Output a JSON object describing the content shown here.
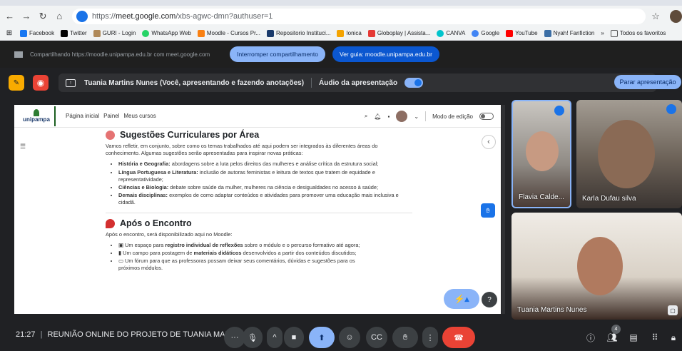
{
  "browser": {
    "url_prefix": "https://",
    "url_domain": "meet.google.com",
    "url_path": "/xbs-agwc-dmn?authuser=1",
    "bookmarks": [
      "Facebook",
      "Twitter",
      "GURI - Login",
      "WhatsApp Web",
      "Moodle - Cursos Pr...",
      "Repositorio Instituci...",
      "Ionica",
      "Globoplay | Assista...",
      "CANVA",
      "Google",
      "YouTube",
      "Nyah! Fanfiction",
      "»",
      "Todos os favoritos"
    ]
  },
  "share_bar": {
    "text": "Compartilhando https://moodle.unipampa.edu.br com meet.google.com",
    "stop_sharing": "Interromper compartilhamento",
    "see_tab": "Ver guia: moodle.unipampa.edu.br"
  },
  "present_bar": {
    "info": "Tuania Martins Nunes (Você, apresentando e fazendo anotações)",
    "audio": "Áudio da apresentação",
    "stop": "Parar apresentação"
  },
  "moodle": {
    "logo": "unipampa",
    "nav": [
      "Página inicial",
      "Painel",
      "Meus cursos"
    ],
    "edit_mode": "Modo de edição",
    "section1_title": "Sugestões Curriculares por Área",
    "section1_intro": "Vamos refletir, em conjunto, sobre como os temas trabalhados até aqui podem ser integrados às diferentes áreas do conhecimento. Algumas sugestões serão apresentadas para inspirar novas práticas:",
    "section1_items": [
      {
        "bold": "História e Geografia:",
        "text": " abordagens sobre a luta pelos direitos das mulheres e análise crítica da estrutura social;"
      },
      {
        "bold": "Língua Portuguesa e Literatura:",
        "text": " inclusão de autoras feministas e leitura de textos que tratem de equidade e representatividade;"
      },
      {
        "bold": "Ciências e Biologia:",
        "text": " debate sobre saúde da mulher, mulheres na ciência e desigualdades no acesso à saúde;"
      },
      {
        "bold": "Demais disciplinas:",
        "text": " exemplos de como adaptar conteúdos e atividades para promover uma educação mais inclusiva e cidadã."
      }
    ],
    "section2_title": "Após o Encontro",
    "section2_intro": "Após o encontro, será disponibilizado aqui no Moodle:",
    "section2_items": [
      {
        "pre": "Um espaço para ",
        "bold": "registro individual de reflexões",
        "text": " sobre o módulo e o percurso formativo até agora;"
      },
      {
        "pre": "Um campo para postagem de ",
        "bold": "materiais didáticos",
        "text": " desenvolvidos a partir dos conteúdos discutidos;"
      },
      {
        "pre": "Um fórum para que as professoras possam deixar seus comentários, dúvidas e sugestões para os",
        "bold": "",
        "text": ""
      }
    ],
    "section2_cut": "próximos módulos."
  },
  "participants": [
    {
      "name": "Flavia Calde..."
    },
    {
      "name": "Karla Dufau silva"
    },
    {
      "name": "Tuania Martins Nunes"
    }
  ],
  "meeting": {
    "time": "21:27",
    "title": "REUNIÃO ONLINE DO PROJETO DE TUANIA MAR...",
    "participant_count": "4"
  },
  "colors": {
    "accent": "#8ab4f8",
    "end_call": "#ea4335",
    "active": "#8ab4f8"
  }
}
